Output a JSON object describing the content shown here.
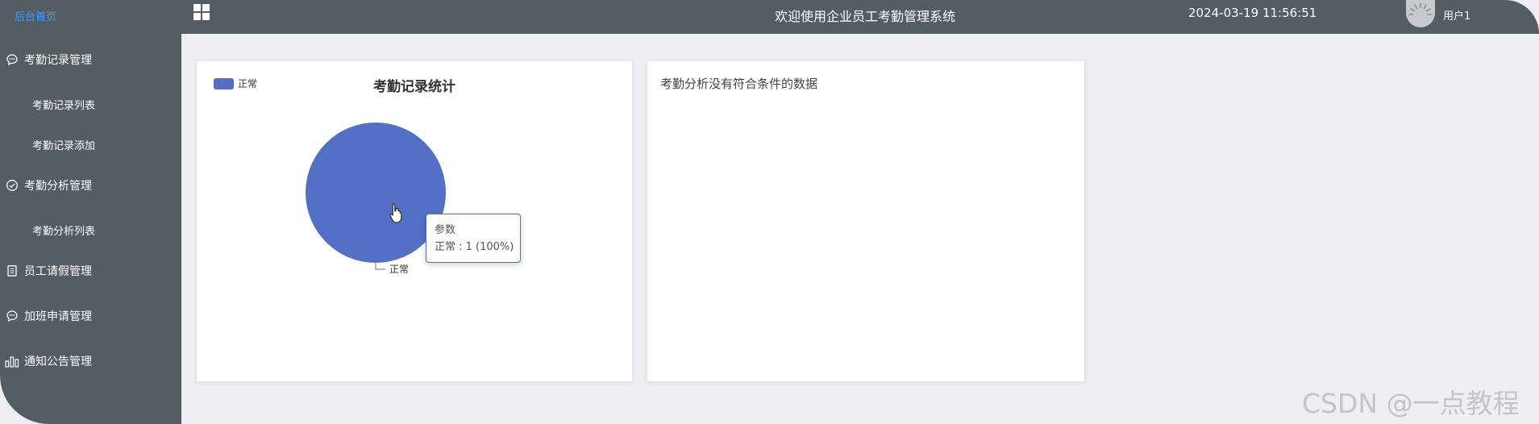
{
  "sidebar": {
    "home": "后台首页",
    "items": [
      {
        "label": "考勤记录管理",
        "icon": "chat-bubble-icon"
      },
      {
        "label": "考勤记录列表"
      },
      {
        "label": "考勤记录添加"
      },
      {
        "label": "考勤分析管理",
        "icon": "check-circle-icon"
      },
      {
        "label": "考勤分析列表"
      },
      {
        "label": "员工请假管理",
        "icon": "document-icon"
      },
      {
        "label": "加班申请管理",
        "icon": "chat-bubble-icon"
      },
      {
        "label": "通知公告管理",
        "icon": "bar-chart-icon"
      }
    ]
  },
  "header": {
    "title": "欢迎使用企业员工考勤管理系统",
    "time": "2024-03-19 11:56:51",
    "user": "用户1"
  },
  "card1": {
    "chart_data": {
      "type": "pie",
      "title": "考勤记录统计",
      "categories": [
        "正常"
      ],
      "values": [
        1
      ],
      "colors": [
        "#5470c6"
      ],
      "legend": "top-left",
      "slice_labels": [
        "正常"
      ]
    },
    "tooltip": {
      "title": "参数",
      "line": "正常 : 1 (100%)"
    }
  },
  "card2": {
    "message": "考勤分析没有符合条件的数据"
  },
  "watermark": "CSDN @一点教程"
}
